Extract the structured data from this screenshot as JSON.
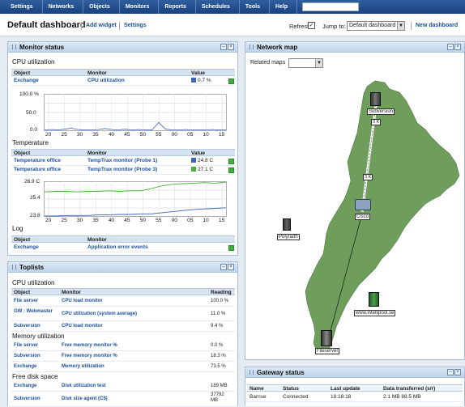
{
  "menu": {
    "items": [
      "Settings",
      "Networks",
      "Objects",
      "Monitors",
      "Reports",
      "Schedules",
      "Tools",
      "Help"
    ]
  },
  "dashbar": {
    "title": "Default dashboard",
    "add_widget": "Add widget",
    "settings": "Settings",
    "refresh_label": "Refresh:",
    "refresh_check": "✓",
    "jump_label": "Jump to:",
    "jump_value": "Default dashboard",
    "new_dashboard": "New dashboard"
  },
  "monitor_status": {
    "title": "Monitor status",
    "cpu": {
      "section": "CPU utilization",
      "cols": [
        "Object",
        "Monitor",
        "Value"
      ],
      "rows": [
        {
          "object": "Exchange",
          "monitor": "CPU utilization",
          "value": "0.7 %"
        }
      ]
    },
    "temp": {
      "section": "Temperature",
      "cols": [
        "Object",
        "Monitor",
        "Value"
      ],
      "rows": [
        {
          "object": "Temperature office",
          "monitor": "TempTrax monitor (Probe 1)",
          "value": "24.8 C"
        },
        {
          "object": "Temperature office",
          "monitor": "TempTrax monitor (Probe 3)",
          "value": "27.1 C"
        }
      ]
    },
    "log": {
      "section": "Log",
      "cols": [
        "Object",
        "Monitor"
      ],
      "rows": [
        {
          "object": "Exchange",
          "monitor": "Application error events"
        }
      ]
    }
  },
  "chart_data": [
    {
      "type": "line",
      "title": "",
      "y_ticks": [
        "100.0 %",
        "50.0",
        "0.0"
      ],
      "ylim": [
        0,
        100
      ],
      "x_ticks": [
        "20",
        "25",
        "30",
        "35",
        "40",
        "45",
        "50",
        "55",
        "00",
        "05",
        "10",
        "15"
      ],
      "series": [
        {
          "values": [
            1,
            2,
            1,
            3,
            6,
            2,
            1,
            1,
            2,
            5,
            2,
            1,
            3,
            1,
            2,
            1,
            1,
            22,
            3,
            1,
            1,
            2,
            1,
            1,
            1,
            2,
            1,
            1
          ]
        }
      ]
    },
    {
      "type": "line",
      "title": "",
      "y_ticks": [
        "26.9 C",
        "25.4",
        "23.8"
      ],
      "ylim": [
        23.8,
        26.9
      ],
      "x_ticks": [
        "20",
        "25",
        "30",
        "35",
        "40",
        "45",
        "50",
        "55",
        "00",
        "05",
        "10",
        "15"
      ],
      "series": [
        {
          "values": [
            26.0,
            26.05,
            26.05,
            26.0,
            26.05,
            26.05,
            26.1,
            26.05,
            26.1,
            26.1,
            26.3,
            26.55,
            26.7,
            26.75,
            26.8,
            26.85,
            26.8,
            26.9
          ]
        },
        {
          "values": [
            23.8,
            23.8,
            23.85,
            23.85,
            23.85,
            23.9,
            23.9,
            23.95,
            23.95,
            24.0,
            24.0,
            24.1,
            24.2,
            24.3,
            24.4,
            24.45,
            24.5,
            24.55
          ]
        }
      ]
    }
  ],
  "toplists": {
    "title": "Toplists",
    "cols": [
      "Object",
      "Monitor",
      "Reading"
    ],
    "groups": [
      {
        "section": "CPU utilization",
        "rows": [
          {
            "object": "File server",
            "monitor": "CPU load monitor",
            "value": "100.0 %"
          },
          {
            "object": "GW : Webmaster",
            "monitor": "CPU utilization (system average)",
            "value": "11.0 %"
          },
          {
            "object": "Subversion",
            "monitor": "CPU load monitor",
            "value": "9.4 %"
          }
        ]
      },
      {
        "section": "Memory utilization",
        "rows": [
          {
            "object": "File server",
            "monitor": "Free memory monitor %",
            "value": "0.0 %"
          },
          {
            "object": "Subversion",
            "monitor": "Free memory monitor %",
            "value": "18.3 %"
          },
          {
            "object": "Exchange",
            "monitor": "Memory utilization",
            "value": "73.5 %"
          }
        ]
      },
      {
        "section": "Free disk space",
        "rows": [
          {
            "object": "Exchange",
            "monitor": "Disk utilization test",
            "value": "189 MB"
          },
          {
            "object": "Subversion",
            "monitor": "Disk size agent (C$)",
            "value": "37792 MB"
          }
        ]
      }
    ]
  },
  "network_map": {
    "title": "Network map",
    "related_label": "Related maps",
    "nodes": [
      "Subversion",
      "Cisco",
      "Polyradh",
      "www.intellipool.se",
      "Fileserver"
    ],
    "link_labels": [
      "3 K",
      "5 K"
    ]
  },
  "gateway": {
    "title": "Gateway status",
    "cols": [
      "Name",
      "Status",
      "Last update",
      "Data transferred (s/r)"
    ],
    "rows": [
      {
        "name": "Barnse",
        "status": "Connected",
        "last_update": "18:18:18",
        "data": "2.1 MB 88.5 MB"
      }
    ]
  },
  "colors": {
    "menubar": "#1b4180",
    "accent": "#1c4f9c",
    "ok": "#3bb33b",
    "map_land": "#6f9e5c"
  }
}
